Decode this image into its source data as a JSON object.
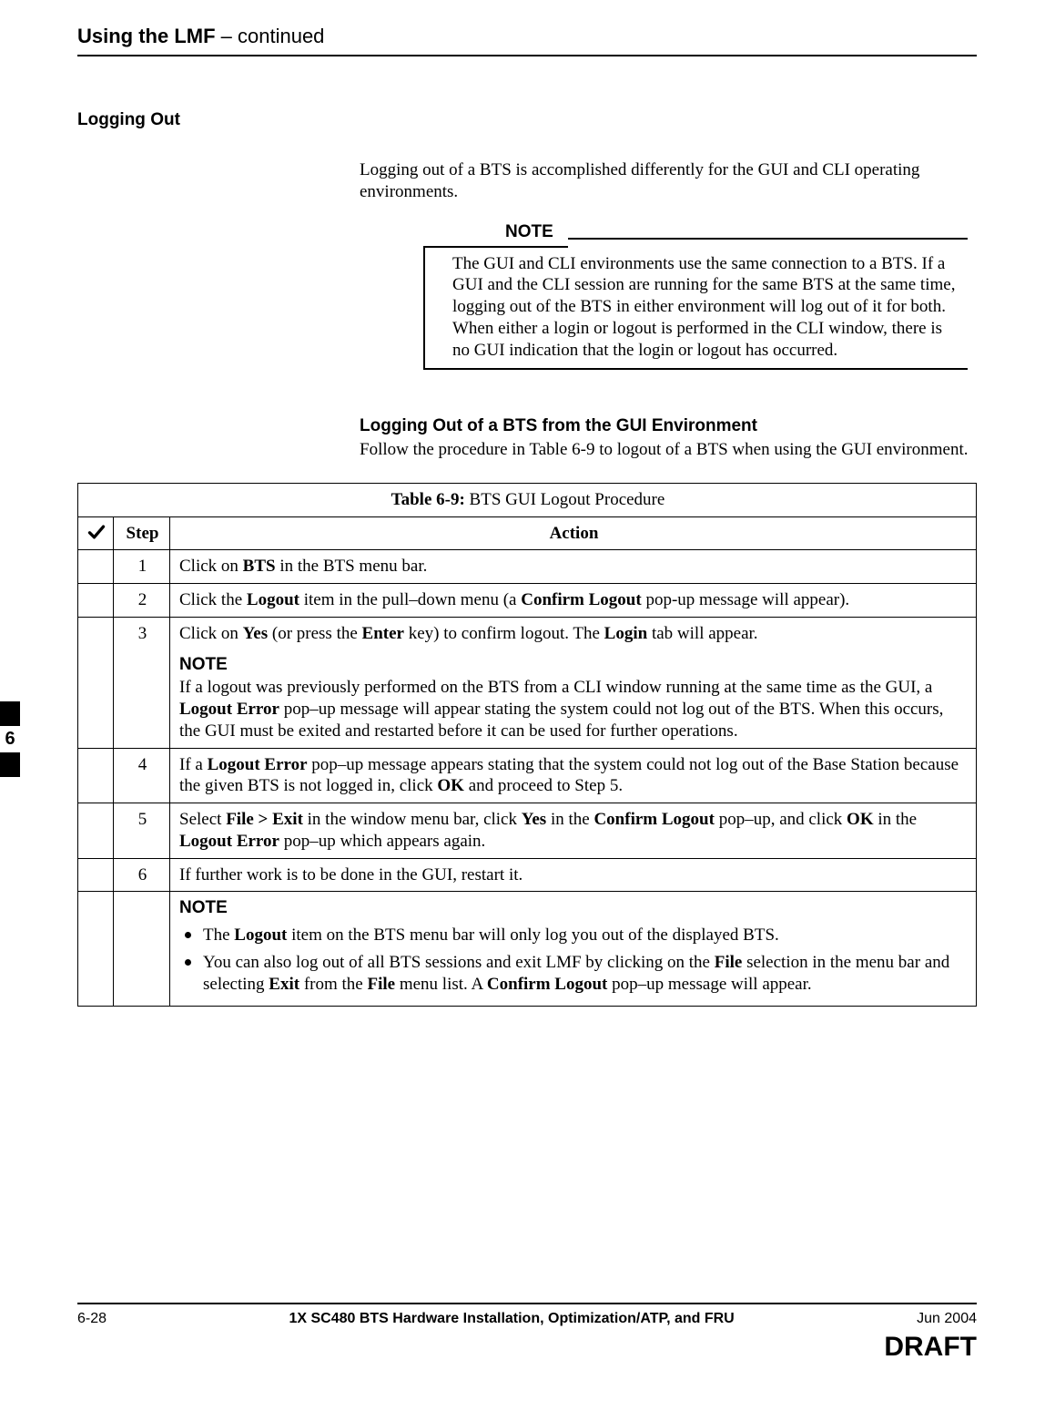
{
  "header": {
    "title_bold": "Using the LMF",
    "title_suffix": "  – continued"
  },
  "section": {
    "heading": "Logging Out",
    "intro": "Logging out of a BTS is accomplished differently for the GUI and CLI operating environments.",
    "note_label": "NOTE",
    "note_body": "The GUI and CLI environments use the same connection to a BTS. If a GUI and the CLI session are running for the same BTS at the same time, logging out of the BTS in either environment will log out of it for both. When either a login or logout is performed in the CLI window, there is no GUI indication that the login or logout has occurred.",
    "subhead": "Logging Out of a BTS from the GUI Environment",
    "subintro_pre": "Follow the procedure in ",
    "subintro_ref": "Table 6-9",
    "subintro_post": " to logout of a BTS when using the GUI environment."
  },
  "table": {
    "title_prefix": "Table 6-9: ",
    "title_rest": "BTS GUI Logout Procedure",
    "col_step": "Step",
    "col_action": "Action",
    "rows": [
      {
        "n": "1",
        "action_html": "Click on <b>BTS</b> in the BTS menu bar."
      },
      {
        "n": "2",
        "action_html": "Click the <b>Logout</b> item in the pull–down menu (a <b>Confirm Logout</b> pop-up message will appear)."
      },
      {
        "n": "3",
        "action_html": "Click on <b>Yes</b> (or press the <b>Enter</b> key) to confirm logout. The <b>Login</b> tab will appear.<span class='inline-note-label'>NOTE</span>If a logout was previously performed on the BTS from a CLI window running at the same time as the GUI, a <b>Logout Error</b> pop–up message will appear stating the system could not log out of the BTS. When this occurs, the GUI must be exited and restarted before it can be used for further operations."
      },
      {
        "n": "4",
        "action_html": "If a <b>Logout Error</b> pop–up message appears stating that the system could not log out of the Base Station because the given BTS is not logged in, click <b>OK</b> and proceed to Step 5."
      },
      {
        "n": "5",
        "action_html": "Select <b>File &gt; Exit</b> in the window menu bar, click <b>Yes</b> in the <b>Confirm Logout</b> pop–up, and click <b>OK</b> in the <b>Logout Error</b> pop–up which appears again."
      },
      {
        "n": "6",
        "action_html": "If further work is to be done in the GUI, restart it."
      }
    ],
    "tail_note_label": "NOTE",
    "tail_bullets": [
      "The <b>Logout</b> item on the BTS menu bar will only log you out of the displayed BTS.",
      "You can also log out of all BTS sessions and exit LMF by clicking on the <b>File</b> selection in the menu bar and selecting <b>Exit</b> from the <b>File</b> menu list. A <b>Confirm Logout</b> pop–up message will appear."
    ]
  },
  "side_tab": {
    "chapter": "6"
  },
  "footer": {
    "page": "6-28",
    "doc": "1X SC480 BTS Hardware Installation, Optimization/ATP, and FRU",
    "date": "Jun 2004",
    "draft": "DRAFT"
  }
}
